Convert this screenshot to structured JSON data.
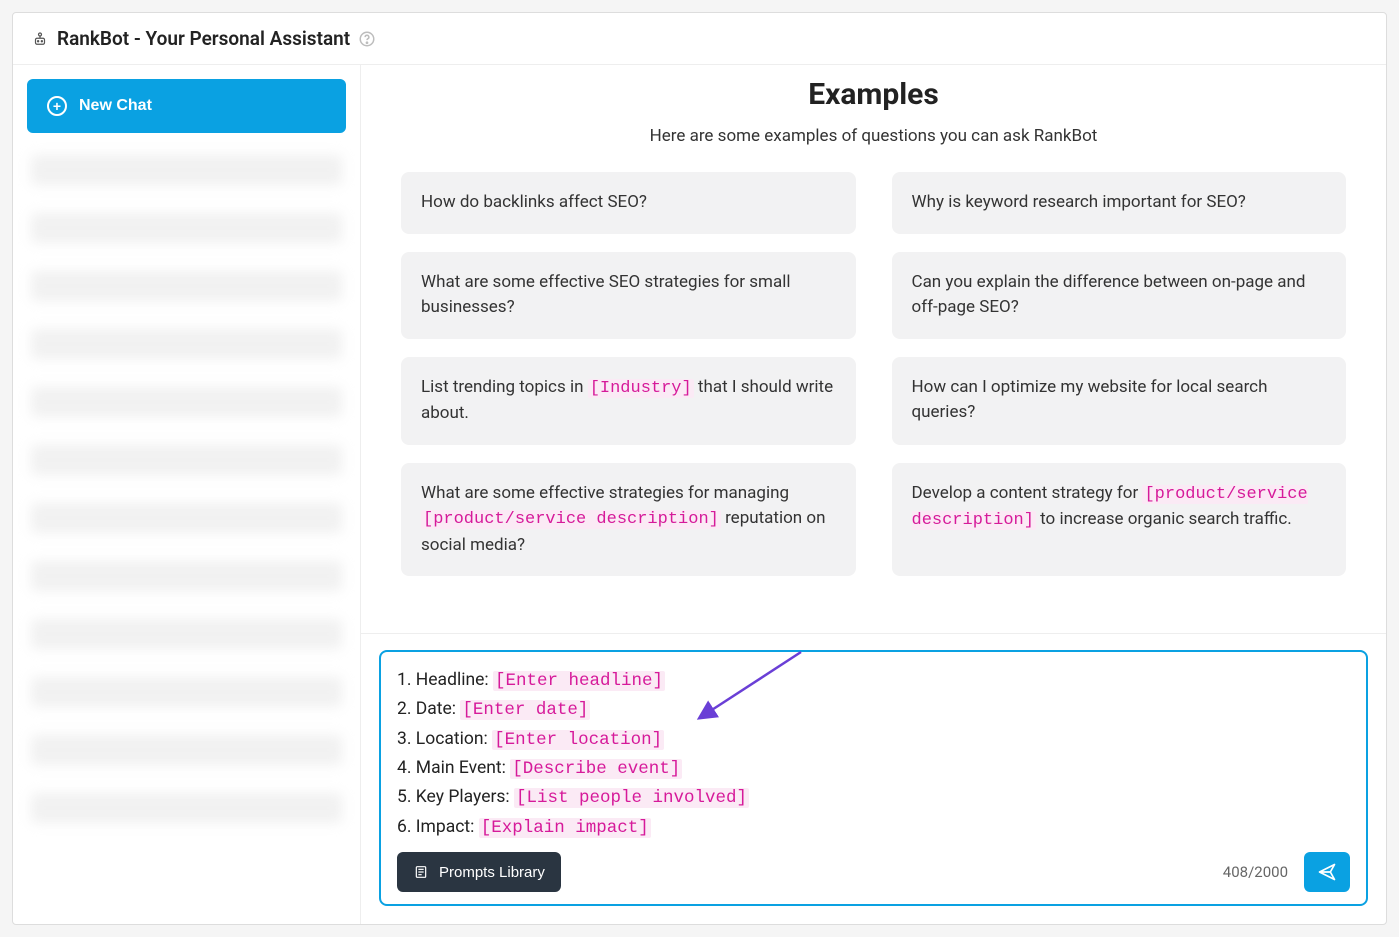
{
  "header": {
    "title": "RankBot - Your Personal Assistant"
  },
  "sidebar": {
    "new_chat_label": "New Chat",
    "blurred_item_count": 12
  },
  "examples": {
    "title": "Examples",
    "subtitle": "Here are some examples of questions you can ask RankBot",
    "cards": [
      {
        "segments": [
          {
            "t": "text",
            "v": "How do backlinks affect SEO?"
          }
        ]
      },
      {
        "segments": [
          {
            "t": "text",
            "v": "Why is keyword research important for SEO?"
          }
        ]
      },
      {
        "segments": [
          {
            "t": "text",
            "v": "What are some effective SEO strategies for small businesses?"
          }
        ]
      },
      {
        "segments": [
          {
            "t": "text",
            "v": "Can you explain the difference between on-page and off-page SEO?"
          }
        ]
      },
      {
        "segments": [
          {
            "t": "text",
            "v": "List trending topics in "
          },
          {
            "t": "var",
            "v": "[Industry]"
          },
          {
            "t": "text",
            "v": " that I should write about."
          }
        ]
      },
      {
        "segments": [
          {
            "t": "text",
            "v": "How can I optimize my website for local search queries?"
          }
        ]
      },
      {
        "segments": [
          {
            "t": "text",
            "v": "What are some effective strategies for managing "
          },
          {
            "t": "var",
            "v": "[product/service description]"
          },
          {
            "t": "text",
            "v": " reputation on social media?"
          }
        ]
      },
      {
        "segments": [
          {
            "t": "text",
            "v": "Develop a content strategy for "
          },
          {
            "t": "var",
            "v": "[product/service description]"
          },
          {
            "t": "text",
            "v": " to increase organic search traffic."
          }
        ]
      }
    ]
  },
  "input": {
    "lines": [
      [
        {
          "t": "text",
          "v": "1. Headline: "
        },
        {
          "t": "var",
          "v": "[Enter headline]"
        }
      ],
      [
        {
          "t": "text",
          "v": "2. Date: "
        },
        {
          "t": "var",
          "v": "[Enter date]"
        }
      ],
      [
        {
          "t": "text",
          "v": "3. Location: "
        },
        {
          "t": "var",
          "v": "[Enter location]"
        }
      ],
      [
        {
          "t": "text",
          "v": "4. Main Event: "
        },
        {
          "t": "var",
          "v": "[Describe event]"
        }
      ],
      [
        {
          "t": "text",
          "v": "5. Key Players: "
        },
        {
          "t": "var",
          "v": "[List people involved]"
        }
      ],
      [
        {
          "t": "text",
          "v": "6. Impact: "
        },
        {
          "t": "var",
          "v": "[Explain impact]"
        }
      ]
    ],
    "prompts_library_label": "Prompts Library",
    "char_count": "408/2000"
  }
}
